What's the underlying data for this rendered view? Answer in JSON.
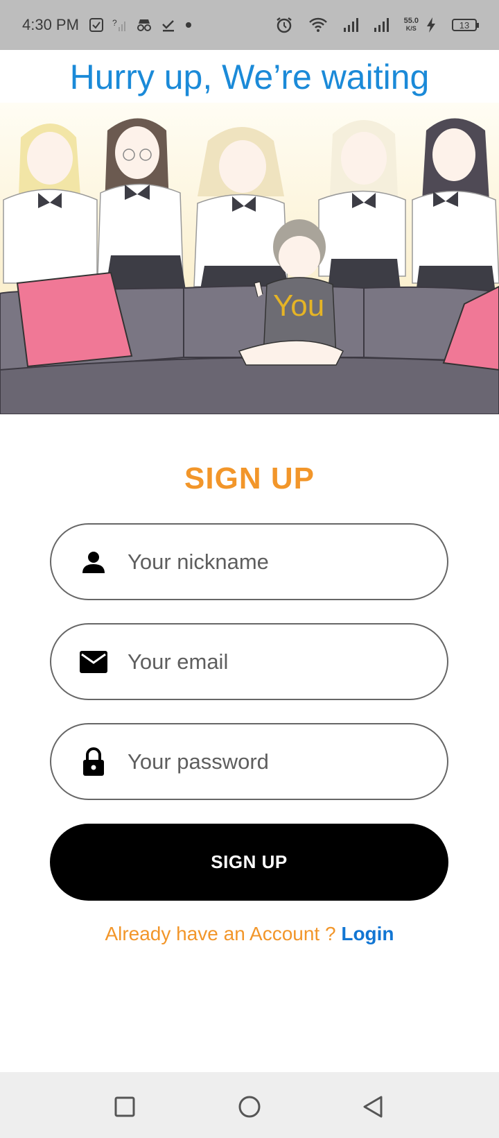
{
  "status_bar": {
    "time": "4:30 PM",
    "speed_value": "55.0",
    "speed_unit": "K/S",
    "battery": "13",
    "icons": [
      "checkbox-icon",
      "no-signal-icon",
      "incognito-icon",
      "download-done-icon",
      "dot-icon",
      "alarm-icon",
      "wifi-icon",
      "signal-icon",
      "signal-icon-2",
      "charging-icon",
      "battery-icon"
    ]
  },
  "hero": {
    "title": "Hurry up, We’re waiting",
    "you_label": "You"
  },
  "signup": {
    "title": "SIGN UP",
    "nickname_placeholder": "Your nickname",
    "email_placeholder": "Your email",
    "password_placeholder": "Your password",
    "button_label": "SIGN UP",
    "already_text": "Already have an Account ? ",
    "login_link": "Login"
  },
  "colors": {
    "title_blue": "#1b8ad8",
    "accent_orange": "#f2962a",
    "link_blue": "#1276d3",
    "button_black": "#000000"
  },
  "nav_bar": {
    "icons": [
      "recent-apps-icon",
      "home-icon",
      "back-icon"
    ]
  }
}
